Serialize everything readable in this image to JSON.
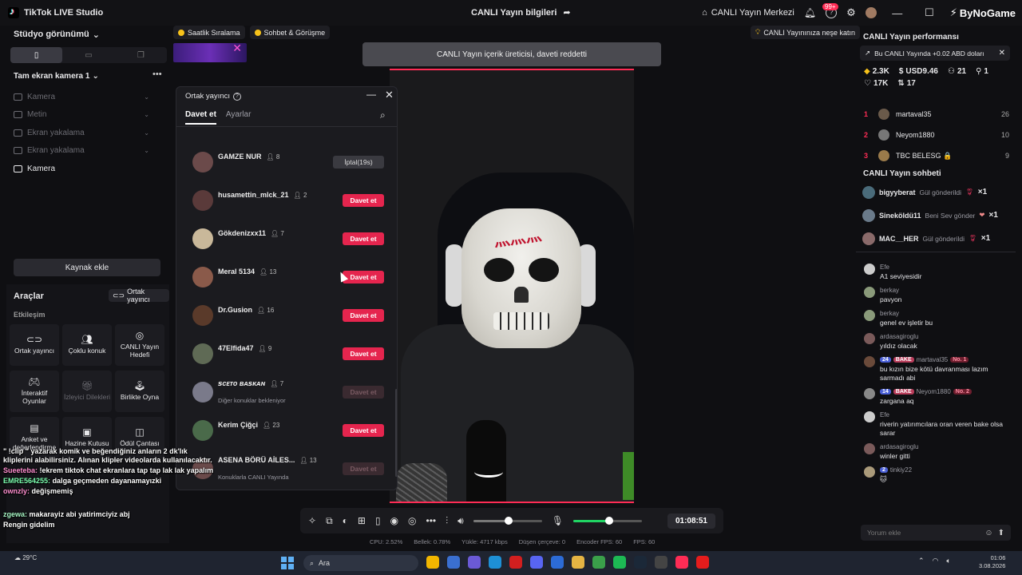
{
  "app": {
    "title": "TikTok LIVE Studio",
    "center_title": "CANLI Yayın bilgileri",
    "hub": "CANLI Yayın Merkezi",
    "notif_count": "99+",
    "watermark": "ByNoGame"
  },
  "left": {
    "studio_view": "Stüdyo görünümü",
    "camera_title": "Tam ekran kamera 1",
    "sources": [
      "Kamera",
      "Metin",
      "Ekran yakalama",
      "Ekran yakalama",
      "Kamera"
    ],
    "add_source": "Kaynak ekle"
  },
  "tools": {
    "title": "Araçlar",
    "cohost_chip": "Ortak yayıncı",
    "section": "Etkileşim",
    "items": [
      {
        "label": "Ortak yayıncı",
        "icon": "link-icon"
      },
      {
        "label": "Çoklu konuk",
        "icon": "users-icon"
      },
      {
        "label": "CANLI Yayın Hedefi",
        "icon": "target-icon"
      },
      {
        "label": "İnteraktif Oyunlar",
        "icon": "gamepad-icon"
      },
      {
        "label": "İzleyici Dilekleri",
        "icon": "gift-icon"
      },
      {
        "label": "Birlikte Oyna",
        "icon": "joystick-icon"
      },
      {
        "label": "Anket ve değerlendirme",
        "icon": "poll-icon"
      },
      {
        "label": "Hazine Kutusu",
        "icon": "chest-icon"
      },
      {
        "label": "Ödül Çantası",
        "icon": "bag-icon"
      }
    ]
  },
  "chips": {
    "rank": "Saatlik Sıralama",
    "chat": "Sohbet & Görüşme",
    "tip": "CANLI Yayınınıza neşe katın"
  },
  "toast": "CANLI Yayın içerik üreticisi, daveti reddetti",
  "modal": {
    "title": "Ortak yayıncı",
    "tab_invite": "Davet et",
    "tab_settings": "Ayarlar",
    "users": [
      {
        "name": "GAMZE NUR",
        "count": "8",
        "button": "İptal(19s)",
        "type": "cancel",
        "sub": ""
      },
      {
        "name": "husamettin_mlck_21",
        "count": "2",
        "button": "Davet et",
        "type": "invite",
        "sub": ""
      },
      {
        "name": "Gökdenizxx11",
        "count": "7",
        "button": "Davet et",
        "type": "invite",
        "sub": ""
      },
      {
        "name": "Meral 5134",
        "count": "13",
        "button": "Davet et",
        "type": "invite",
        "sub": ""
      },
      {
        "name": "Dr.Gusion",
        "count": "16",
        "button": "Davet et",
        "type": "invite",
        "sub": ""
      },
      {
        "name": "47Elfida47",
        "count": "9",
        "button": "Davet et",
        "type": "invite",
        "sub": ""
      },
      {
        "name": "ꜱᴄᴇᴛᴏ ʙᴀꜱᴋᴀɴ",
        "count": "7",
        "button": "Davet et",
        "type": "disabled",
        "sub": "Diğer konuklar bekleniyor"
      },
      {
        "name": "Kerim Çiğçi",
        "count": "23",
        "button": "Davet et",
        "type": "invite",
        "sub": ""
      },
      {
        "name": "ASENA BÖRÜ AİLES...",
        "count": "13",
        "button": "Davet et",
        "type": "disabled",
        "sub": "Konuklarla CANLI Yayında"
      }
    ]
  },
  "controls": {
    "timer": "01:08:51",
    "volume": 0.52,
    "mic": 0.52
  },
  "stats": {
    "cpu": "CPU: 2.52%",
    "mem": "Bellek: 0.78%",
    "upload": "Yükle: 4717 kbps",
    "drop": "Düşen çerçeve: 0",
    "enc": "Encoder FPS: 60",
    "fps": "FPS: 60"
  },
  "right": {
    "perf_title": "CANLI Yayın performansı",
    "perf_note": "Bu CANLI Yayında +0.02 ABD doları",
    "perf_stats": [
      "2.3K",
      "USD9.46",
      "21",
      "1",
      "17K",
      "17"
    ],
    "ranks": [
      {
        "n": "1",
        "name": "martaval35",
        "v": "26"
      },
      {
        "n": "2",
        "name": "Neyom1880",
        "v": "10"
      },
      {
        "n": "3",
        "name": "TBC BELESG 🔒",
        "v": "9"
      }
    ],
    "chat_title": "CANLI Yayın sohbeti",
    "gifts": [
      {
        "name": "bigyyberat",
        "text": "Gül gönderildi",
        "x": "×1"
      },
      {
        "name": "Sineköldü11",
        "text": "Beni Sev gönder",
        "x": "×1"
      },
      {
        "name": "MAC__HER",
        "text": "Gül gönderildi",
        "x": "×1"
      }
    ],
    "messages": [
      {
        "name": "Efe",
        "text": "A1 seviyesidir"
      },
      {
        "name": "berkay",
        "text": "pavyon"
      },
      {
        "name": "berkay",
        "text": "genel ev işletir bu"
      },
      {
        "name": "ardasagiroglu",
        "text": "yıldız olacak"
      },
      {
        "name": "martaval35",
        "lvl": "24",
        "fan": "BAKE",
        "no": "No. 1",
        "text": "bu kızın bize kötü davranması lazım sarmadı abi"
      },
      {
        "name": "Neyom1880",
        "lvl": "14",
        "fan": "BAKE",
        "no": "No. 2",
        "text": "zargana aq"
      },
      {
        "name": "Efe",
        "text": "riverin yatırımcılara oran veren bake olsa sarar"
      },
      {
        "name": "ardasagiroglu",
        "text": "winler gitti"
      },
      {
        "name": "tinkiy22",
        "lvl": "2",
        "text": "🐱"
      }
    ],
    "comment_placeholder": "Yorum ekle"
  },
  "overlay_chat": [
    {
      "user": "",
      "text": "\" !clip \" yazarak komik ve beğendiğiniz anların 2 dk'lık kliplerini alabilirsiniz. Alınan klipler videolarda kullanılacaktır."
    },
    {
      "user": "Sueeteba:",
      "text": "!ekrem tiktok chat ekranlara tap tap lak lak yapalım"
    },
    {
      "user": "EMRE564255:",
      "text": "dalga geçmeden dayanamayızki"
    },
    {
      "user": "ownzly:",
      "text": "değişmemiş"
    },
    {
      "user": "zgewa:",
      "text": "makarayiz abi yatirimciyiz abj"
    },
    {
      "user": "",
      "text": "Rengin gidelim"
    }
  ],
  "taskbar": {
    "weather": "29°C",
    "search": "Ara",
    "time": "01:06",
    "date": "3.08.2026"
  }
}
